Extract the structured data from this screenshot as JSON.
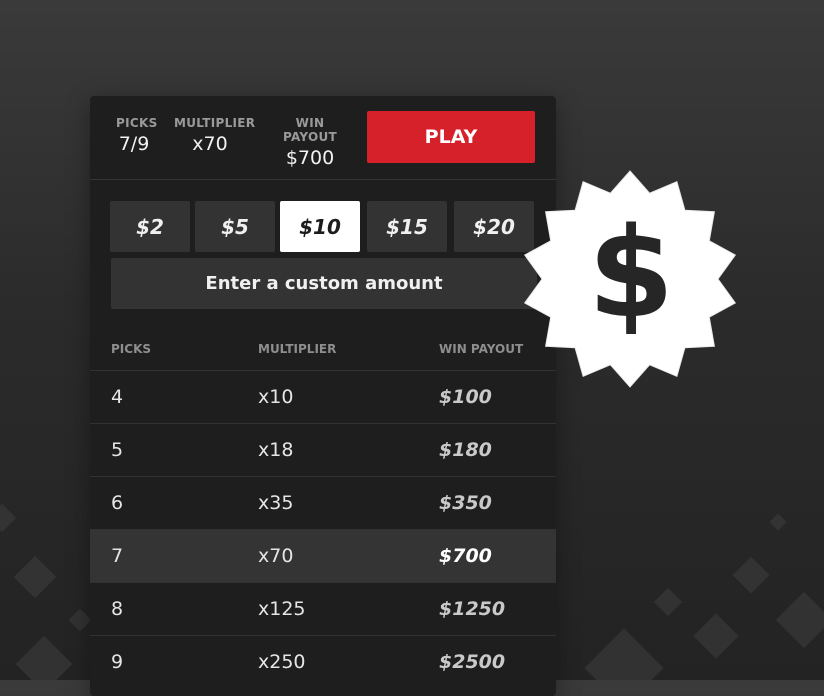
{
  "summary": {
    "picks_label": "PICKS",
    "picks_value": "7/9",
    "multiplier_label": "MULTIPLIER",
    "multiplier_value": "x70",
    "payout_label": "WIN PAYOUT",
    "payout_value": "$700",
    "play_label": "PLAY"
  },
  "amounts": [
    "$2",
    "$5",
    "$10",
    "$15",
    "$20"
  ],
  "selected_amount": "$10",
  "custom_amount_label": "Enter a custom amount",
  "table": {
    "headers": [
      "PICKS",
      "MULTIPLIER",
      "WIN PAYOUT"
    ],
    "rows": [
      {
        "picks": "4",
        "multiplier": "x10",
        "payout": "$100"
      },
      {
        "picks": "5",
        "multiplier": "x18",
        "payout": "$180"
      },
      {
        "picks": "6",
        "multiplier": "x35",
        "payout": "$350"
      },
      {
        "picks": "7",
        "multiplier": "x70",
        "payout": "$700"
      },
      {
        "picks": "8",
        "multiplier": "x125",
        "payout": "$1250"
      },
      {
        "picks": "9",
        "multiplier": "x250",
        "payout": "$2500"
      }
    ],
    "highlighted_row": "7"
  },
  "badge": {
    "icon": "dollar-seal-icon",
    "glyph": "$"
  },
  "colors": {
    "accent": "#d6202a",
    "panel": "#1e1e1e",
    "button": "#333333",
    "highlight_row": "#343434"
  }
}
